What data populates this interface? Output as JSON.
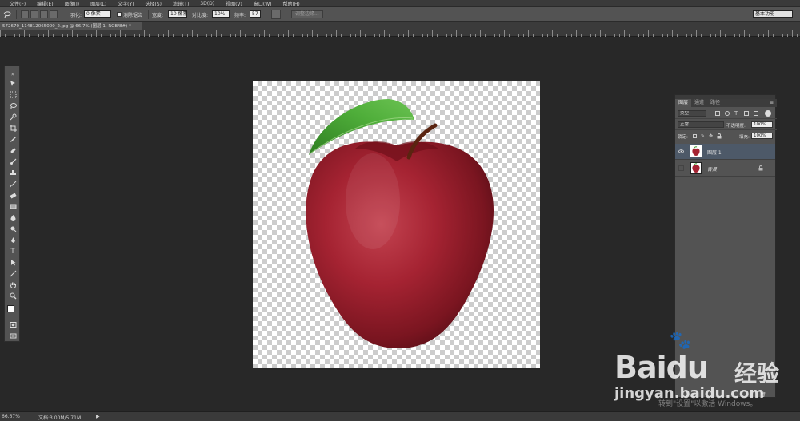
{
  "menubar": {
    "items": [
      "文件(F)",
      "编辑(E)",
      "图像(I)",
      "图层(L)",
      "文字(Y)",
      "选择(S)",
      "滤镜(T)",
      "3D(D)",
      "视图(V)",
      "窗口(W)",
      "帮助(H)"
    ]
  },
  "options": {
    "feather_label": "羽化:",
    "feather_value": "0 像素",
    "antialias_label": "消除锯齿",
    "width_label": "宽度:",
    "width_value": "10 像素",
    "contrast_label": "对比度:",
    "contrast_value": "10%",
    "frequency_label": "频率:",
    "frequency_value": "57",
    "refine_edge_label": "调整边缘...",
    "workspace_value": "基本功能"
  },
  "document": {
    "tab_title": "572670_114812065000_2.jpg @ 66.7% (图层 1, RGB/8#) *"
  },
  "layers_panel": {
    "tabs": [
      "图层",
      "通道",
      "路径"
    ],
    "active_tab": 0,
    "filter_kind": "类型",
    "blend_mode": "正常",
    "opacity_label": "不透明度:",
    "opacity_value": "100%",
    "lock_label": "锁定:",
    "fill_label": "填充:",
    "fill_value": "100%",
    "layers": [
      {
        "name": "图层 1",
        "selected": true,
        "visible": true
      },
      {
        "name": "背景",
        "selected": false,
        "visible": false,
        "locked": true
      }
    ]
  },
  "statusbar": {
    "zoom": "66.67%",
    "doc_info": "文档:3.00M/5.71M"
  },
  "watermark": {
    "brand": "Bai",
    "brand_paw": "du",
    "cn": "经验",
    "url": "jingyan.baidu.com",
    "windows_notice": "转到\"设置\"以激活 Windows。"
  },
  "colors": {
    "apple_red": "#9e1f2a",
    "leaf_green": "#3f9a2c",
    "panel_bg": "#535353",
    "selected_layer": "#4d5968"
  },
  "icons": [
    "lasso-icon",
    "eye-icon",
    "lock-icon",
    "hand-icon",
    "zoom-icon"
  ]
}
